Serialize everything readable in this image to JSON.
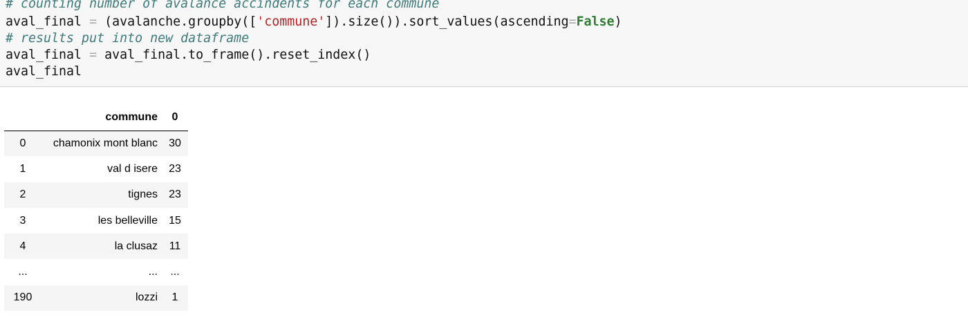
{
  "code": {
    "comment1": "# counting number of avalance accindents for each commune",
    "line2": {
      "lhs": "aval_final",
      "eq": "=",
      "pre": "(avalanche.groupby([",
      "str": "'commune'",
      "mid": "]).size()).sort_values(ascending",
      "eq2": "=",
      "kw": "False",
      "post": ")"
    },
    "comment2": "# results put into new dataframe",
    "line4": {
      "lhs": "aval_final",
      "eq": "=",
      "rhs": "aval_final.to_frame().reset_index()"
    },
    "line5": "aval_final"
  },
  "output": {
    "headers": [
      "",
      "commune",
      "0"
    ],
    "rows": [
      [
        "0",
        "chamonix mont blanc",
        "30"
      ],
      [
        "1",
        "val d isere",
        "23"
      ],
      [
        "2",
        "tignes",
        "23"
      ],
      [
        "3",
        "les belleville",
        "15"
      ],
      [
        "4",
        "la clusaz",
        "11"
      ],
      [
        "...",
        "...",
        "..."
      ],
      [
        "190",
        "lozzi",
        "1"
      ]
    ]
  }
}
